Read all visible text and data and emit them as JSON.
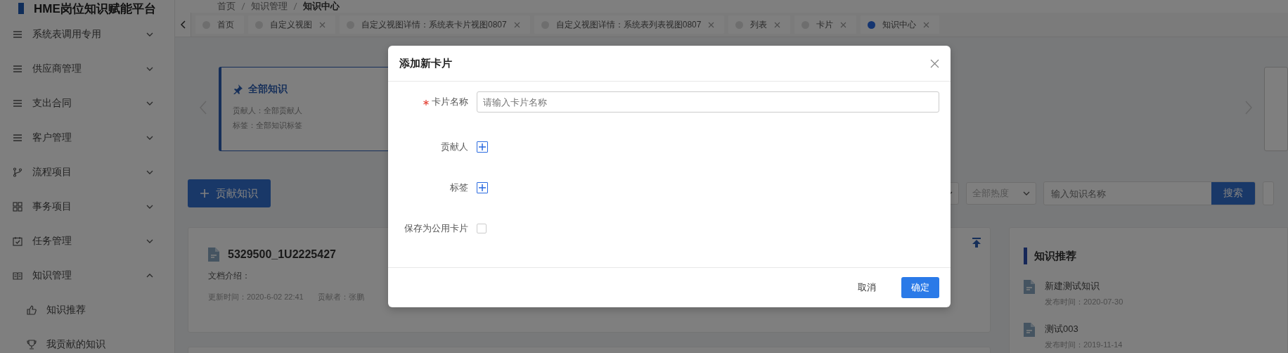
{
  "sidebar": {
    "title": "HME岗位知识赋能平台",
    "items": [
      {
        "label": "系统表调用专用",
        "kind": "list",
        "expanded": false
      },
      {
        "label": "供应商管理",
        "kind": "list",
        "expanded": false
      },
      {
        "label": "支出合同",
        "kind": "list",
        "expanded": false
      },
      {
        "label": "客户管理",
        "kind": "list",
        "expanded": false
      },
      {
        "label": "流程项目",
        "kind": "branch",
        "expanded": false
      },
      {
        "label": "事务项目",
        "kind": "grid",
        "expanded": false
      },
      {
        "label": "任务管理",
        "kind": "calendar",
        "expanded": false
      },
      {
        "label": "知识管理",
        "kind": "book",
        "expanded": true,
        "children": [
          {
            "label": "知识推荐",
            "kind": "thumb"
          },
          {
            "label": "我贡献的知识",
            "kind": "trophy"
          }
        ]
      }
    ]
  },
  "header": {
    "breadcrumb": [
      "首页",
      "知识管理",
      "知识中心"
    ]
  },
  "tabs": [
    {
      "label": "首页",
      "closable": false,
      "selected": false
    },
    {
      "label": "自定义视图",
      "closable": true,
      "selected": false
    },
    {
      "label": "自定义视图详情：系统表卡片视图0807",
      "closable": true,
      "selected": false
    },
    {
      "label": "自定义视图详情：系统表列表视图0807",
      "closable": true,
      "selected": false
    },
    {
      "label": "列表",
      "closable": true,
      "selected": false
    },
    {
      "label": "卡片",
      "closable": true,
      "selected": false
    },
    {
      "label": "知识中心",
      "closable": true,
      "selected": true
    }
  ],
  "view_cards": [
    {
      "title": "全部知识",
      "contributor": "贡献人：全部贡献人",
      "tags": "标签：全部知识标签"
    }
  ],
  "toolbar": {
    "contribute_button": "贡献知识",
    "heat_filter": "全部热度",
    "search_placeholder": "输入知识名称",
    "search_button": "搜索"
  },
  "documents": [
    {
      "title": "5329500_1U2225427",
      "intro": "文档介绍：",
      "updated": "更新时间：2020-6-02 22:41",
      "contributor": "贡献者：张鹏"
    }
  ],
  "recommend": {
    "title": "知识推荐",
    "items": [
      {
        "title": "新建测试知识",
        "date": "发布时间：2020-07-30"
      },
      {
        "title": "测试003",
        "date": "发布时间：2019-11-14"
      }
    ]
  },
  "dialog": {
    "title": "添加新卡片",
    "fields": [
      {
        "kind": "text",
        "label": "卡片名称",
        "required": true,
        "placeholder": "请输入卡片名称"
      },
      {
        "kind": "add",
        "label": "贡献人",
        "required": false
      },
      {
        "kind": "add",
        "label": "标签",
        "required": false
      },
      {
        "kind": "checkbox",
        "label": "保存为公用卡片",
        "required": false,
        "checked": false
      }
    ],
    "buttons": [
      {
        "label": "取消",
        "primary": false
      },
      {
        "label": "确定",
        "primary": true
      }
    ]
  }
}
